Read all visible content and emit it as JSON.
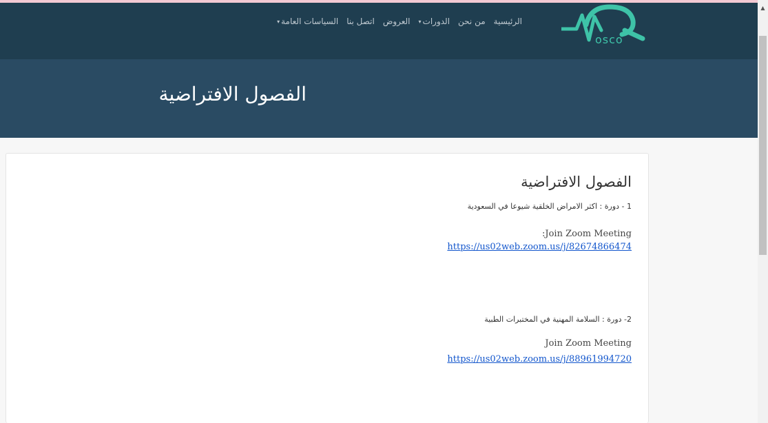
{
  "brand": {
    "logo_text": "osco",
    "colors": {
      "logo_green": "#3ec3a8",
      "navbar": "#1f3e50",
      "banner": "#2a4b63",
      "link": "#1155cc"
    }
  },
  "nav": {
    "items": [
      {
        "label": "الرئيسية",
        "dropdown": false
      },
      {
        "label": "من نحن",
        "dropdown": false
      },
      {
        "label": "الدورات",
        "dropdown": true
      },
      {
        "label": "العروض",
        "dropdown": false
      },
      {
        "label": "اتصل بنا",
        "dropdown": false
      },
      {
        "label": "السياسات العامة",
        "dropdown": true
      }
    ],
    "caret_icon": "▾"
  },
  "banner": {
    "title": "الفصول الافتراضية"
  },
  "card": {
    "heading": "الفصول الافتراضية",
    "courses": [
      {
        "title": "1 - دورة : اكثر الامراض الخلقية شيوعا في السعودية",
        "zoom_label": ":Join Zoom Meeting",
        "zoom_url": "https://us02web.zoom.us/j/82674866474"
      },
      {
        "title": "2- دورة : السلامة المهنية في المختبرات الطبية",
        "zoom_label": "Join Zoom Meeting",
        "zoom_url": "https://us02web.zoom.us/j/88961994720"
      }
    ]
  },
  "scrollbar": {
    "up_arrow": "▲"
  }
}
